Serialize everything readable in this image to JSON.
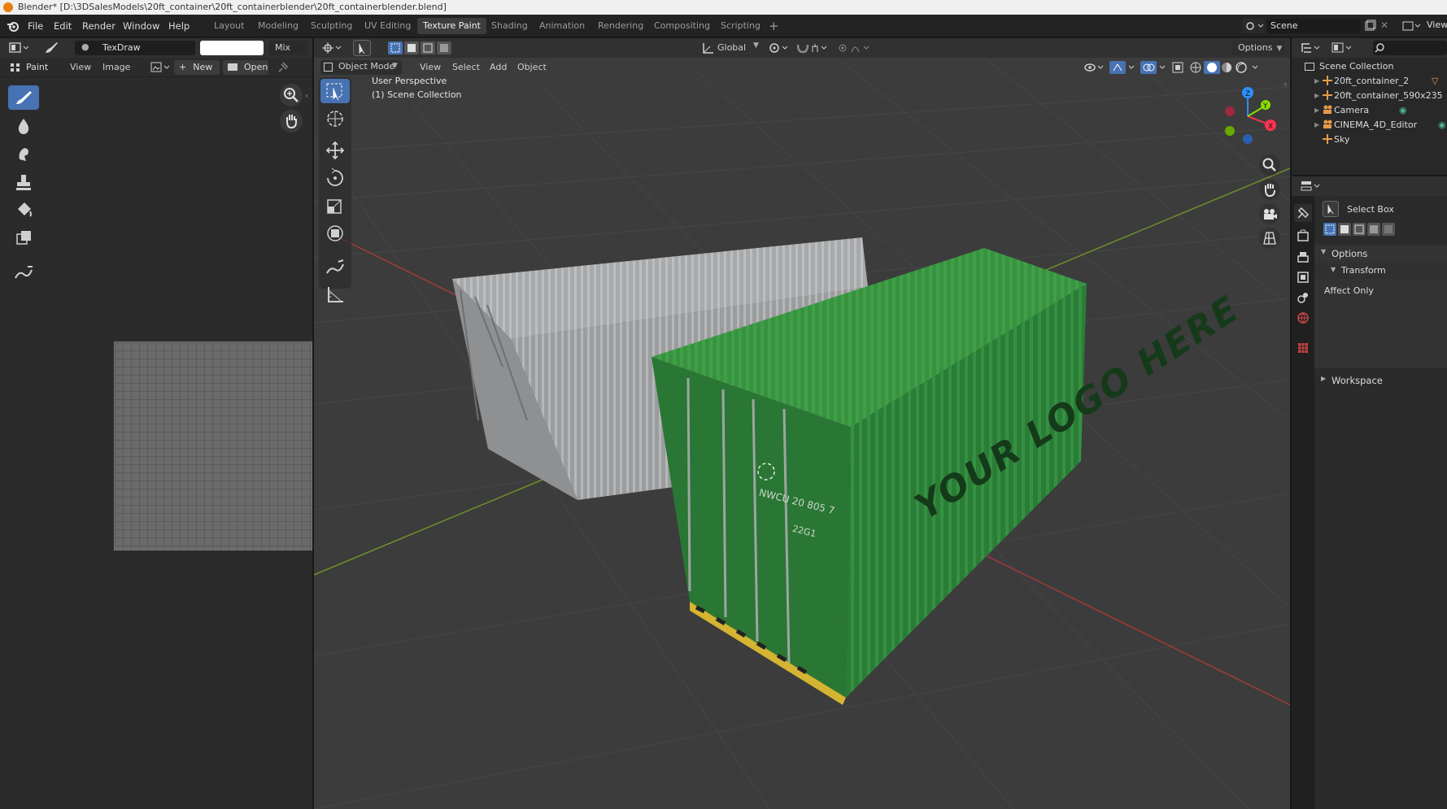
{
  "titlebar": {
    "title": "Blender* [D:\\3DSalesModels\\20ft_container\\20ft_containerblender\\20ft_containerblender.blend]"
  },
  "menu": {
    "file": "File",
    "edit": "Edit",
    "render": "Render",
    "window": "Window",
    "help": "Help"
  },
  "workspaces": [
    {
      "label": "Layout"
    },
    {
      "label": "Modeling"
    },
    {
      "label": "Sculpting"
    },
    {
      "label": "UV Editing"
    },
    {
      "label": "Texture Paint"
    },
    {
      "label": "Shading"
    },
    {
      "label": "Animation"
    },
    {
      "label": "Rendering"
    },
    {
      "label": "Compositing"
    },
    {
      "label": "Scripting"
    }
  ],
  "topright": {
    "scene_label": "Scene",
    "view_layer_label": "View"
  },
  "image_editor": {
    "brush_name": "TexDraw",
    "blend_mode": "Mix",
    "mode": "Paint",
    "view": "View",
    "image": "Image",
    "new": "New",
    "open": "Open"
  },
  "viewport": {
    "orientation": "Global",
    "options": "Options",
    "mode": "Object Mode",
    "view": "View",
    "select": "Select",
    "add": "Add",
    "object": "Object",
    "overlay_line1": "User Perspective",
    "overlay_line2": "(1) Scene Collection",
    "container_text": "YOUR LOGO HERE",
    "container_id": "NWCU 20 805 7",
    "container_code": "22G1",
    "gizmo": {
      "x": "X",
      "y": "Y",
      "z": "Z"
    }
  },
  "outliner": {
    "root": "Scene Collection",
    "items": [
      {
        "label": "20ft_container_2"
      },
      {
        "label": "20ft_container_590x235"
      },
      {
        "label": "Camera"
      },
      {
        "label": "CINEMA_4D_Editor"
      },
      {
        "label": "Sky"
      }
    ]
  },
  "properties": {
    "tool": "Select Box",
    "options": "Options",
    "transform": "Transform",
    "affect_only": "Affect Only",
    "workspace": "Workspace"
  },
  "colors": {
    "accent": "#4772b3",
    "active_tab": "#3d3d3d",
    "panel": "#303030",
    "viewport": "#3d3d3d",
    "container_green": "#2e8a3e"
  }
}
